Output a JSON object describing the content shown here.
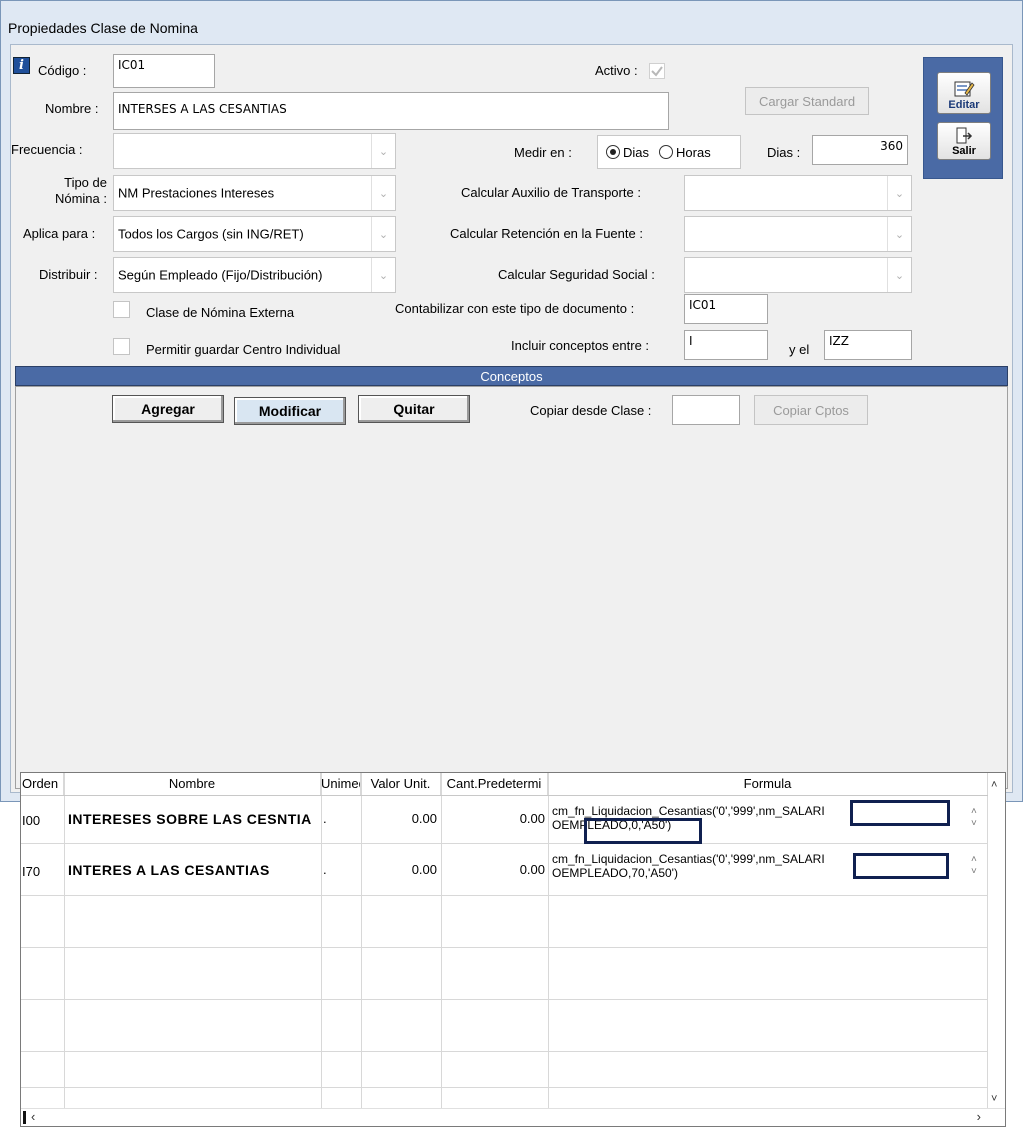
{
  "window": {
    "title": "Propiedades Clase de Nomina"
  },
  "form": {
    "codigo": {
      "label": "Código :",
      "value": "IC01"
    },
    "activo": {
      "label": "Activo :"
    },
    "nombre": {
      "label": "Nombre :",
      "value": "INTERSES A LAS CESANTIAS"
    },
    "cargar_standard": "Cargar Standard",
    "frecuencia": {
      "label": "Frecuencia :",
      "value": ""
    },
    "medir_en": {
      "label": "Medir en :",
      "opt_dias": "Dias",
      "opt_horas": "Horas",
      "selected": "Dias"
    },
    "dias": {
      "label": "Dias :",
      "value": "360"
    },
    "tipo_nomina": {
      "label_1": "Tipo de",
      "label_2": "Nómina :",
      "value": "NM Prestaciones Intereses"
    },
    "auxilio": {
      "label": "Calcular Auxilio de Transporte :",
      "value": ""
    },
    "aplica_para": {
      "label": "Aplica para :",
      "value": "Todos los Cargos (sin ING/RET)"
    },
    "retencion": {
      "label": "Calcular Retención en la Fuente :",
      "value": ""
    },
    "distribuir": {
      "label": "Distribuir :",
      "value": "Según Empleado (Fijo/Distribución)"
    },
    "seguridad": {
      "label": "Calcular Seguridad Social :",
      "value": ""
    },
    "clase_externa": {
      "label": "Clase de Nómina Externa"
    },
    "contabilizar": {
      "label": "Contabilizar con este tipo de documento :",
      "value": "IC01"
    },
    "centro_individual": {
      "label": "Permitir guardar Centro Individual"
    },
    "incluir": {
      "label": "Incluir conceptos entre :",
      "from": "I",
      "and_label": "y el",
      "to": "IZZ"
    }
  },
  "side": {
    "editar": "Editar",
    "salir": "Salir"
  },
  "conceptos": {
    "header": "Conceptos",
    "agregar": "Agregar",
    "modificar": "Modificar",
    "quitar": "Quitar",
    "copiar_desde": "Copiar desde Clase :",
    "copiar_desde_value": "",
    "copiar_cptos": "Copiar Cptos",
    "columns": [
      "Orden",
      "Nombre",
      "Unimed",
      "Valor Unit.",
      "Cant.Predetermi",
      "Formula"
    ],
    "rows": [
      {
        "orden": "I00",
        "nombre": "INTERESES SOBRE LAS CESNTIA",
        "unimed": ".",
        "valor": "0.00",
        "cant": "0.00",
        "formula_1": "cm_fn_Liquidacion_Cesantias('0','999',nm_SALARI",
        "formula_2": "OEMPLEADO,0,'A50')"
      },
      {
        "orden": "I70",
        "nombre": "INTERES A LAS CESANTIAS",
        "unimed": ".",
        "valor": "0.00",
        "cant": "0.00",
        "formula_1": "cm_fn_Liquidacion_Cesantias('0','999',nm_SALARI",
        "formula_2": "OEMPLEADO,70,'A50')"
      }
    ]
  },
  "icons": {
    "info": "info-icon",
    "editar": "edit-icon",
    "salir": "exit-icon"
  },
  "colors": {
    "accent": "#4a6aa5",
    "highlight_box": "#102050"
  }
}
